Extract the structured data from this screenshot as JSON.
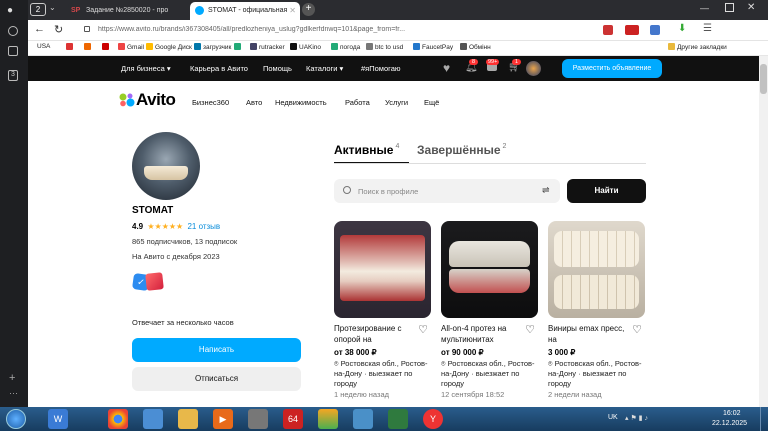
{
  "browser": {
    "tabs": [
      {
        "label": "Задание №2850020 - про",
        "fav_color": "#d4484b",
        "fav_text": "SP"
      },
      {
        "label": "STOMAT - официальная",
        "fav_color": "#0af",
        "fav_text": ""
      }
    ],
    "tab_counter": "2",
    "url": "https://www.avito.ru/brands/i367308405/all/predlozheniya_uslug?gdlkerfdnwq=101&page_from=fr...",
    "bookmarks": [
      {
        "label": "USA",
        "color": "#999"
      },
      {
        "label": "",
        "color": "#d33"
      },
      {
        "label": "",
        "color": "#e60"
      },
      {
        "label": "",
        "color": "#c00"
      },
      {
        "label": "Gmail",
        "color": "#e44"
      },
      {
        "label": "Google Диск",
        "color": "#fb0"
      },
      {
        "label": "загрузчик",
        "color": "#07a"
      },
      {
        "label": "",
        "color": "#2a7"
      },
      {
        "label": "rutracker",
        "color": "#446"
      },
      {
        "label": "UAKino",
        "color": "#111"
      },
      {
        "label": "погода",
        "color": "#2a7"
      },
      {
        "label": "btc to usd",
        "color": "#777"
      },
      {
        "label": "FaucetPay",
        "color": "#27c"
      },
      {
        "label": "Обмінн",
        "color": "#555"
      },
      {
        "label": "Другие закладки",
        "color": "#e9b93c"
      }
    ]
  },
  "avito_top": {
    "items": [
      "Для бизнеса",
      "Карьера в Авито",
      "Помощь",
      "Каталоги",
      "#яПомогаю"
    ],
    "badge_1": "8",
    "badge_2": "99+",
    "badge_3": "1",
    "post_button": "Разместить объявление"
  },
  "main_nav": {
    "logo": "Avito",
    "items": [
      "Бизнес360",
      "Авто",
      "Недвижимость",
      "Работа",
      "Услуги",
      "Ещё"
    ]
  },
  "profile": {
    "name": "STOMAT",
    "rating": "4.9",
    "stars": "★★★★★",
    "reviews": "21 отзыв",
    "followers": "865 подписчиков, 13 подписок",
    "since": "На Авито с декабря 2023",
    "response": "Отвечает за несколько часов",
    "message_button": "Написать",
    "unsubscribe_button": "Отписаться"
  },
  "listings_tabs": {
    "active_label": "Активные",
    "active_count": "4",
    "closed_label": "Завершённые",
    "closed_count": "2"
  },
  "search": {
    "placeholder": "Поиск в профиле",
    "button": "Найти"
  },
  "items": [
    {
      "title": "Протезирование с опорой на",
      "price": "от 38 000 ₽",
      "location": "Ростовская обл., Ростов-на-Дону · выезжает по городу",
      "date": "1 неделю назад"
    },
    {
      "title": "All-on-4 протез на мультиюнитах",
      "price": "от 90 000 ₽",
      "location": "Ростовская обл., Ростов-на-Дону · выезжает по городу",
      "date": "12 сентября 18:52"
    },
    {
      "title": "Виниры emax пресс, на",
      "price": "3 000 ₽",
      "location": "Ростовская обл., Ростов-на-Дону · выезжает по городу",
      "date": "2 недели назад"
    }
  ],
  "taskbar": {
    "lang": "UK",
    "time": "16:02",
    "date": "22.12.2025"
  }
}
